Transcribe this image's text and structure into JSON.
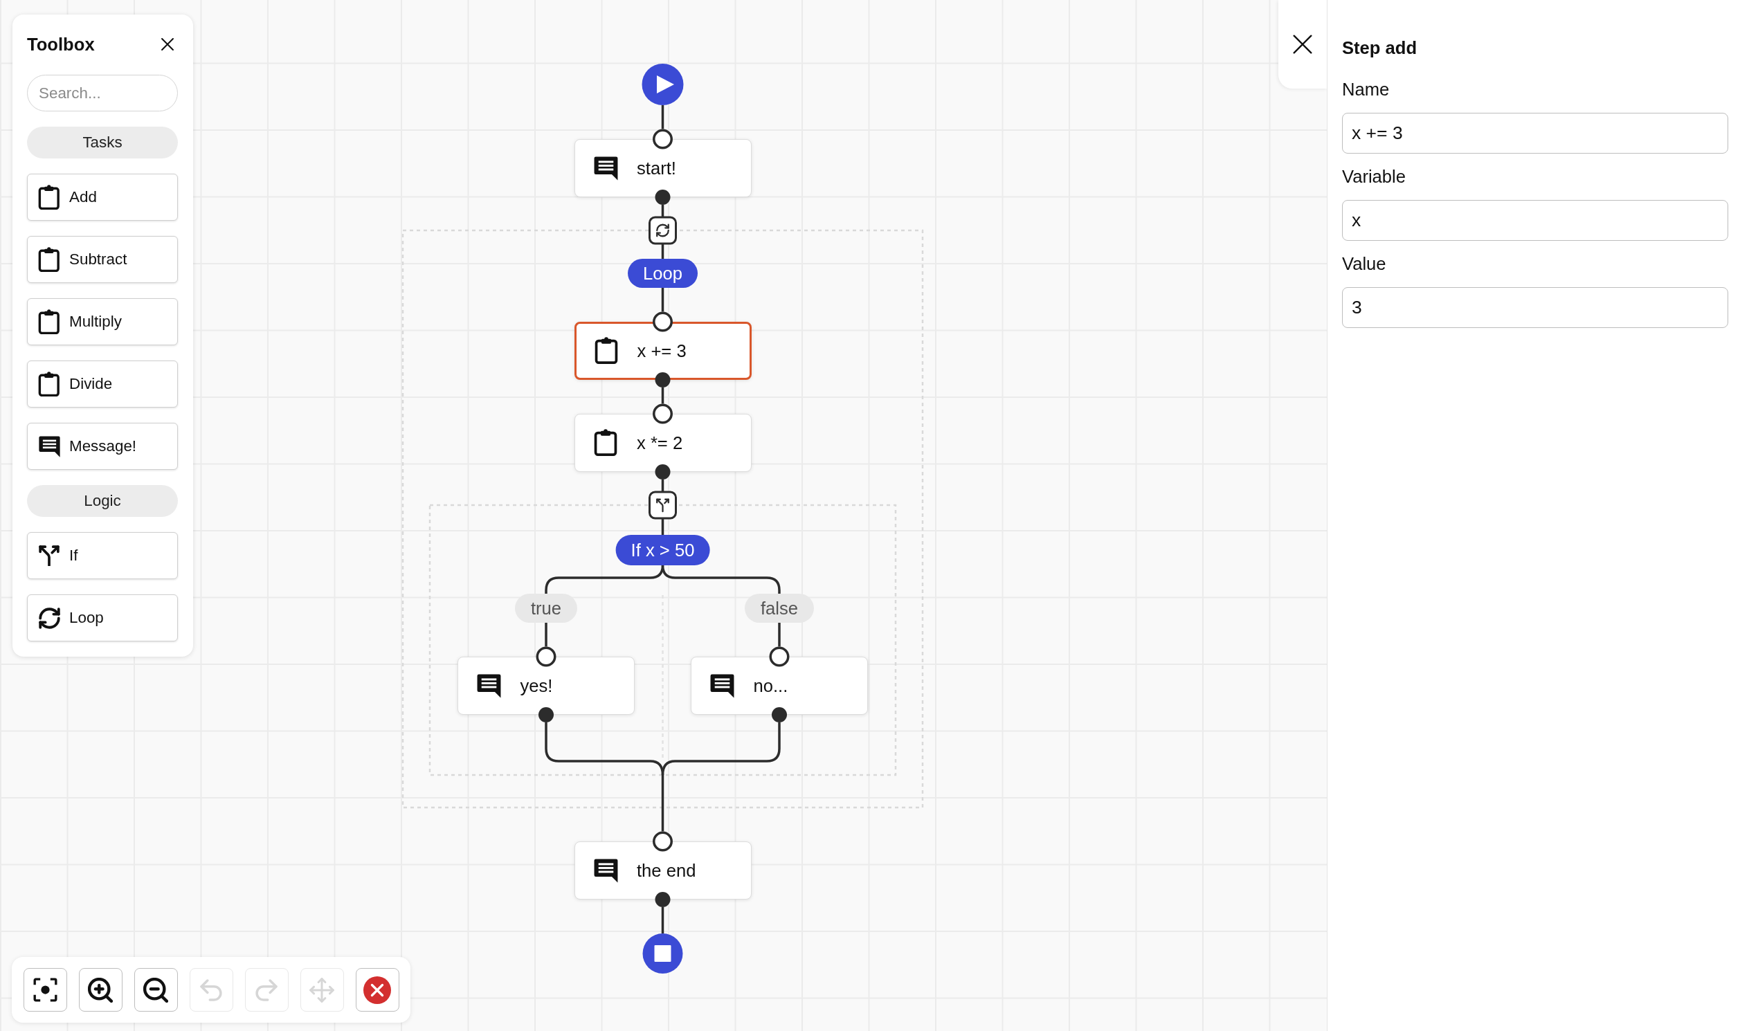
{
  "toolbox": {
    "title": "Toolbox",
    "search": {
      "placeholder": "Search..."
    },
    "groups": [
      {
        "title": "Tasks",
        "items": [
          {
            "label": "Add",
            "kind": "task"
          },
          {
            "label": "Subtract",
            "kind": "task"
          },
          {
            "label": "Multiply",
            "kind": "task"
          },
          {
            "label": "Divide",
            "kind": "task"
          },
          {
            "label": "Message!",
            "kind": "message"
          }
        ]
      },
      {
        "title": "Logic",
        "items": [
          {
            "label": "If",
            "kind": "if"
          },
          {
            "label": "Loop",
            "kind": "loop"
          }
        ]
      }
    ]
  },
  "flow": {
    "steps": [
      {
        "kind": "message",
        "label": "start!",
        "selected": false
      },
      {
        "kind": "loop",
        "label": "Loop",
        "selected": false,
        "children": [
          {
            "kind": "task",
            "label": "x += 3",
            "selected": true
          },
          {
            "kind": "task",
            "label": "x *= 2",
            "selected": false
          },
          {
            "kind": "if",
            "label": "If x > 50",
            "selected": false,
            "branches": [
              {
                "label": "true",
                "children": [
                  {
                    "kind": "message",
                    "label": "yes!",
                    "selected": false
                  }
                ]
              },
              {
                "label": "false",
                "children": [
                  {
                    "kind": "message",
                    "label": "no...",
                    "selected": false
                  }
                ]
              }
            ]
          }
        ]
      },
      {
        "kind": "message",
        "label": "the end",
        "selected": false
      }
    ]
  },
  "toolbar": {
    "buttons": [
      {
        "kind": "fit",
        "disabled": false
      },
      {
        "kind": "zoom_in",
        "disabled": false
      },
      {
        "kind": "zoom_out",
        "disabled": false
      },
      {
        "kind": "undo",
        "disabled": true
      },
      {
        "kind": "redo",
        "disabled": true
      },
      {
        "kind": "move",
        "disabled": true
      },
      {
        "kind": "delete",
        "disabled": false
      }
    ]
  },
  "inspector": {
    "title": "Step add",
    "fields": [
      {
        "label": "Name",
        "value": "x += 3"
      },
      {
        "label": "Variable",
        "value": "x"
      },
      {
        "label": "Value",
        "value": "3"
      }
    ]
  }
}
